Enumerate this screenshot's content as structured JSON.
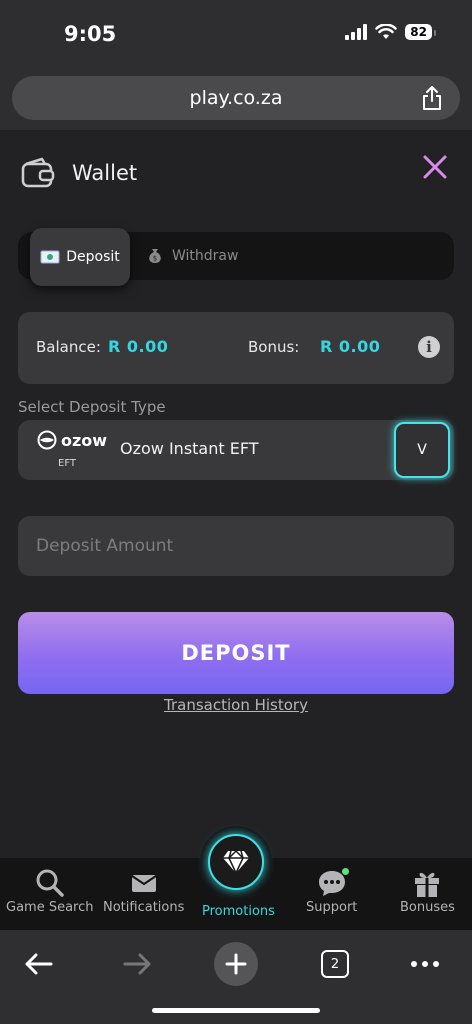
{
  "status": {
    "time": "9:05",
    "battery": "82"
  },
  "browser": {
    "url": "play.co.za",
    "tab_count": "2"
  },
  "wallet": {
    "title": "Wallet",
    "tabs": {
      "deposit": "Deposit",
      "withdraw": "Withdraw"
    },
    "balance_label": "Balance:",
    "balance_value": "R 0.00",
    "bonus_label": "Bonus:",
    "bonus_value": "R 0.00",
    "select_label": "Select Deposit Type",
    "deposit_type": {
      "brand": "ozow",
      "sub": "EFT",
      "name": "Ozow Instant EFT",
      "dropdown_glyph": "V"
    },
    "amount_placeholder": "Deposit Amount",
    "deposit_button": "DEPOSIT",
    "history_link": "Transaction History"
  },
  "nav": [
    {
      "label": "Game Search",
      "icon": "search-icon"
    },
    {
      "label": "Notifications",
      "icon": "mail-icon"
    },
    {
      "label": "Promotions",
      "icon": "diamond-icon",
      "active": true
    },
    {
      "label": "Support",
      "icon": "chat-icon"
    },
    {
      "label": "Bonuses",
      "icon": "gift-icon"
    }
  ],
  "colors": {
    "accent": "#39d8de",
    "button_top": "#b98de6",
    "button_bottom": "#7666f2",
    "close": "#d98ae8"
  }
}
